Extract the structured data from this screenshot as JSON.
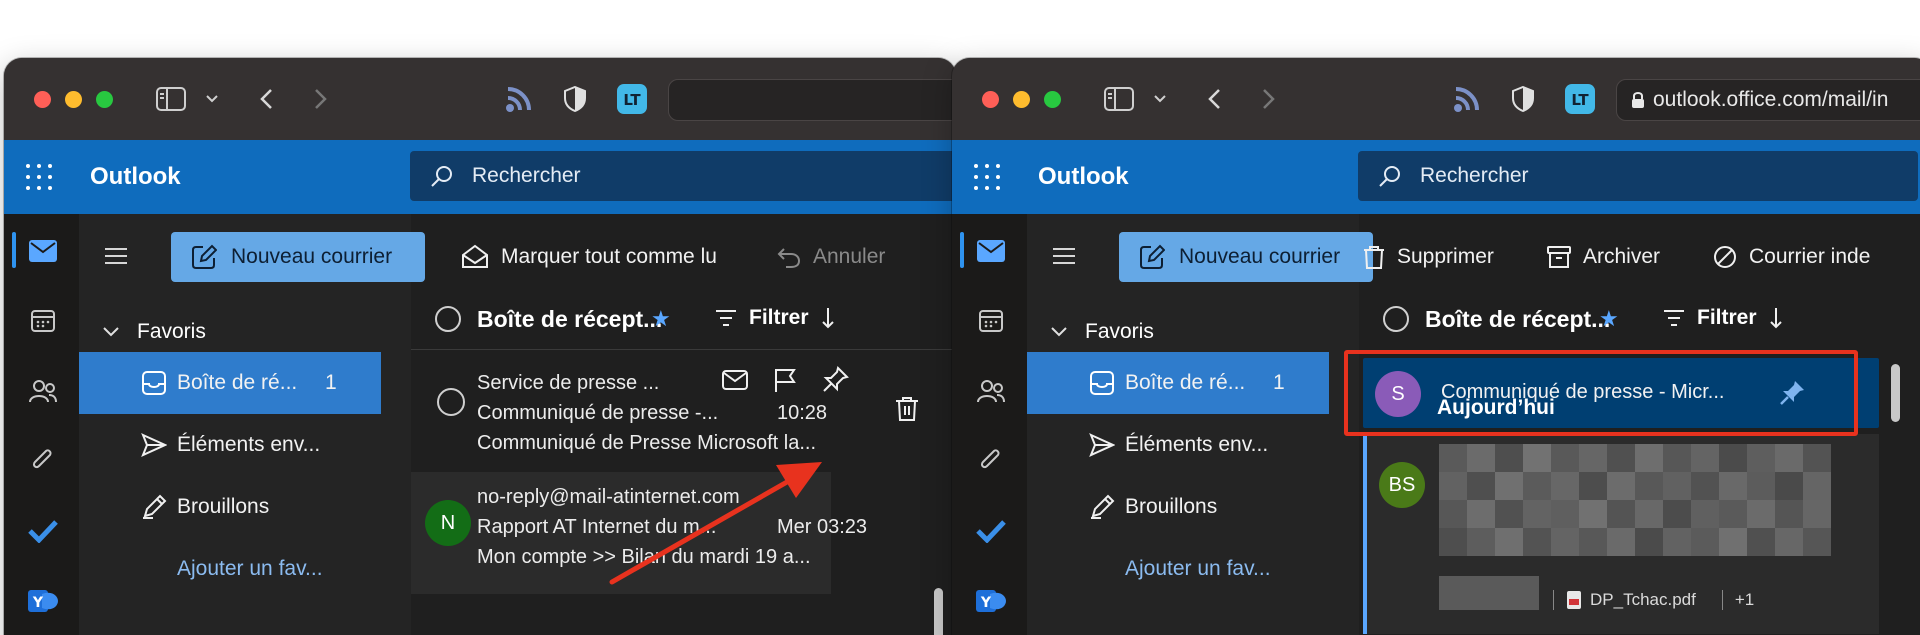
{
  "left_window": {
    "address_text": "",
    "brand": "Outlook",
    "search_placeholder": "Rechercher",
    "toolbar": {
      "new_mail": "Nouveau courrier",
      "mark_all_read": "Marquer tout comme lu",
      "undo": "Annuler"
    },
    "folders": {
      "favorites": "Favoris",
      "inbox": "Boîte de ré...",
      "inbox_count": "1",
      "sent": "Éléments env...",
      "drafts": "Brouillons",
      "add_favorite": "Ajouter un fav..."
    },
    "list_header": {
      "title": "Boîte de récept...",
      "filter": "Filtrer"
    },
    "messages": [
      {
        "sender": "Service de presse ...",
        "subject": "Communiqué de presse -...",
        "time": "10:28",
        "preview": "Communiqué de Presse Microsoft la..."
      },
      {
        "sender": "no-reply@mail-atinternet.com",
        "subject": "Rapport AT Internet du m...",
        "time": "Mer 03:23",
        "preview": "Mon compte >> Bilan du mardi 19 a...",
        "initial": "N"
      }
    ]
  },
  "right_window": {
    "address_text": "outlook.office.com/mail/in",
    "brand": "Outlook",
    "search_placeholder": "Rechercher",
    "toolbar": {
      "new_mail": "Nouveau courrier",
      "delete": "Supprimer",
      "archive": "Archiver",
      "junk": "Courrier inde"
    },
    "folders": {
      "favorites": "Favoris",
      "inbox": "Boîte de ré...",
      "inbox_count": "1",
      "sent": "Éléments env...",
      "drafts": "Brouillons",
      "add_favorite": "Ajouter un fav..."
    },
    "list_header": {
      "title": "Boîte de récept...",
      "filter": "Filtrer"
    },
    "pinned": {
      "initial": "S",
      "subject": "Communiqué de presse - Micr..."
    },
    "section": "Aujourd’hui",
    "blurred": {
      "initials": "BS",
      "attachment": "DP_Tchac.pdf",
      "more": "+1"
    }
  },
  "colors": {
    "brand_blue": "#0f6cbd",
    "highlight_red": "#e8321e",
    "selected_folder": "#2f7ccc",
    "pinned_bg": "#003f72",
    "avatar_s": "#8a5bb8",
    "avatar_n": "#136d16",
    "avatar_bs": "#4a7a18"
  }
}
